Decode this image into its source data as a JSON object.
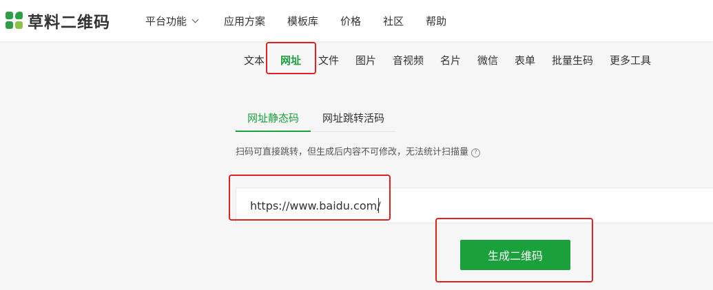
{
  "brand": {
    "name": "草料二维码"
  },
  "nav": {
    "items": [
      {
        "label": "平台功能",
        "has_dropdown": true
      },
      {
        "label": "应用方案"
      },
      {
        "label": "模板库"
      },
      {
        "label": "价格"
      },
      {
        "label": "社区"
      },
      {
        "label": "帮助"
      }
    ]
  },
  "categories": {
    "active": "网址",
    "items": [
      "文本",
      "网址",
      "文件",
      "图片",
      "音视频",
      "名片",
      "微信",
      "表单",
      "批量生码",
      "更多工具"
    ]
  },
  "subtabs": {
    "active": "网址静态码",
    "items": [
      "网址静态码",
      "网址跳转活码"
    ]
  },
  "hint": {
    "text": "扫码可直接跳转，但生成后内容不可修改，无法统计扫描量",
    "help_icon": "?"
  },
  "url_input": {
    "value": "https://www.baidu.com/"
  },
  "generate_button": {
    "label": "生成二维码"
  },
  "colors": {
    "accent": "#1aa13c",
    "highlight": "#e02020"
  }
}
